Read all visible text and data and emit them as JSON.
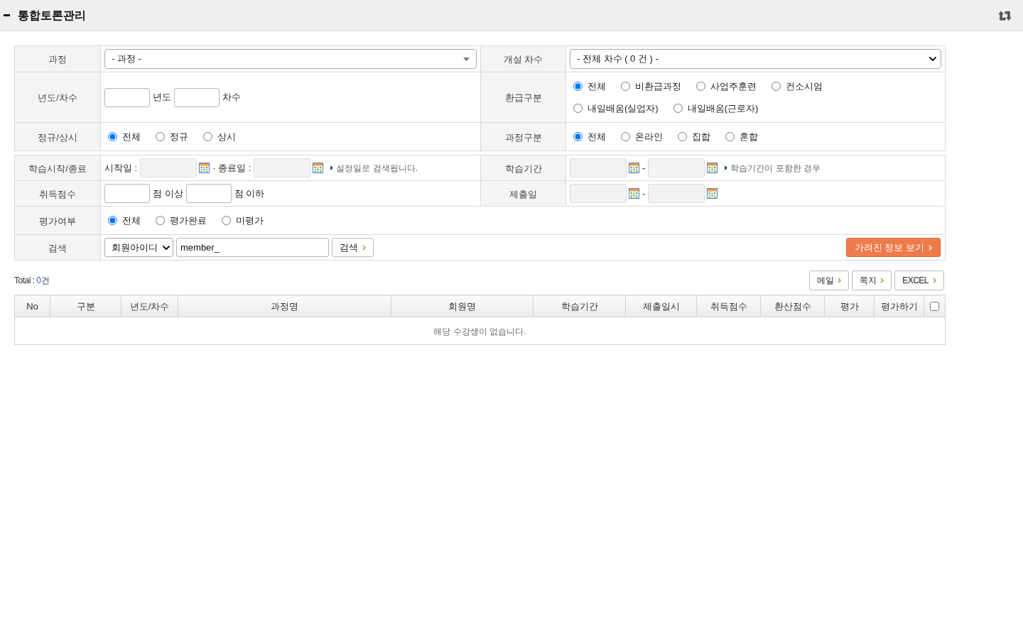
{
  "header": {
    "title": "통합토론관리"
  },
  "filter_tables": [
    {
      "rows": [
        {
          "cells": [
            {
              "label": "과정",
              "controls": [
                {
                  "kind": "combo",
                  "value": "- 과정 -"
                }
              ]
            },
            {
              "label": "개설 차수",
              "controls": [
                {
                  "kind": "select",
                  "value": "- 전체 차수 ( 0 건 ) -"
                }
              ]
            }
          ]
        },
        {
          "cells": [
            {
              "label": "년도/차수",
              "controls": [
                {
                  "kind": "short_input"
                },
                {
                  "kind": "text",
                  "text": "년도"
                },
                {
                  "kind": "short_input"
                },
                {
                  "kind": "text",
                  "text": "차수"
                }
              ]
            },
            {
              "label": "환급구분",
              "controls": [
                {
                  "kind": "radio",
                  "option_rows": [
                    [
                      {
                        "label": "전체",
                        "selected": true
                      },
                      {
                        "label": "비환급과정",
                        "selected": false
                      },
                      {
                        "label": "사업주훈련",
                        "selected": false
                      },
                      {
                        "label": "컨소시엄",
                        "selected": false
                      }
                    ],
                    [
                      {
                        "label": "내일배움(실업자)",
                        "selected": false
                      },
                      {
                        "label": "내일배움(근로자)",
                        "selected": false
                      }
                    ]
                  ]
                }
              ]
            }
          ]
        },
        {
          "cells": [
            {
              "label": "정규/상시",
              "controls": [
                {
                  "kind": "radio",
                  "option_rows": [
                    [
                      {
                        "label": "전체",
                        "selected": true
                      },
                      {
                        "label": "정규",
                        "selected": false
                      },
                      {
                        "label": "상시",
                        "selected": false
                      }
                    ]
                  ]
                }
              ]
            },
            {
              "label": "과정구분",
              "controls": [
                {
                  "kind": "radio",
                  "option_rows": [
                    [
                      {
                        "label": "전체",
                        "selected": true
                      },
                      {
                        "label": "온라인",
                        "selected": false
                      },
                      {
                        "label": "집합",
                        "selected": false
                      },
                      {
                        "label": "혼합",
                        "selected": false
                      }
                    ]
                  ]
                }
              ]
            }
          ]
        }
      ]
    },
    {
      "rows": [
        {
          "cells": [
            {
              "label": "학습시작/종료",
              "controls": [
                {
                  "kind": "text",
                  "text": "시작일 :"
                },
                {
                  "kind": "date"
                },
                {
                  "kind": "text",
                  "text": "· 종료일 :"
                },
                {
                  "kind": "date"
                },
                {
                  "kind": "hint",
                  "text": "설정일로 검색됩니다."
                }
              ]
            },
            {
              "label": "학습기간",
              "controls": [
                {
                  "kind": "date"
                },
                {
                  "kind": "text",
                  "text": "-"
                },
                {
                  "kind": "date"
                },
                {
                  "kind": "hint",
                  "text": "학습기간이 포함한 경우"
                }
              ]
            }
          ]
        },
        {
          "cells": [
            {
              "label": "취득점수",
              "controls": [
                {
                  "kind": "short_input"
                },
                {
                  "kind": "text",
                  "text": "점 이상"
                },
                {
                  "kind": "short_input"
                },
                {
                  "kind": "text",
                  "text": "점 이하"
                }
              ]
            },
            {
              "label": "제출일",
              "controls": [
                {
                  "kind": "date"
                },
                {
                  "kind": "text",
                  "text": "-"
                },
                {
                  "kind": "date"
                }
              ]
            }
          ]
        },
        {
          "cells": [
            {
              "label": "평가여부",
              "controls": [
                {
                  "kind": "radio",
                  "option_rows": [
                    [
                      {
                        "label": "전체",
                        "selected": true
                      },
                      {
                        "label": "평가완료",
                        "selected": false
                      },
                      {
                        "label": "미평가",
                        "selected": false
                      }
                    ]
                  ]
                }
              ]
            }
          ]
        },
        {
          "cells": [
            {
              "label": "검색",
              "controls": [
                {
                  "kind": "compact_select",
                  "value": "회원아이디"
                },
                {
                  "kind": "keyword_input",
                  "value": "member_"
                },
                {
                  "kind": "button",
                  "text": "검색"
                },
                {
                  "kind": "accent_button",
                  "text": "가려진 정보 보기"
                }
              ]
            }
          ]
        }
      ]
    }
  ],
  "results": {
    "total": {
      "label": "Total :",
      "count": "0",
      "unit": "건"
    },
    "actions": [
      "메일",
      "쪽지",
      "EXCEL"
    ],
    "table": {
      "columns": [
        {
          "kind": "text",
          "label": "No"
        },
        {
          "kind": "text",
          "label": "구분"
        },
        {
          "kind": "text",
          "label": "년도/차수"
        },
        {
          "kind": "text",
          "label": "과정명"
        },
        {
          "kind": "text",
          "label": "회원명"
        },
        {
          "kind": "text",
          "label": "학습기간"
        },
        {
          "kind": "text",
          "label": "제출일시"
        },
        {
          "kind": "text",
          "label": "취득점수"
        },
        {
          "kind": "text",
          "label": "환산점수"
        },
        {
          "kind": "text",
          "label": "평가"
        },
        {
          "kind": "text",
          "label": "평가하기"
        },
        {
          "kind": "checkbox",
          "checked": false
        }
      ],
      "empty_message": "해당 수강생이 없습니다."
    }
  }
}
